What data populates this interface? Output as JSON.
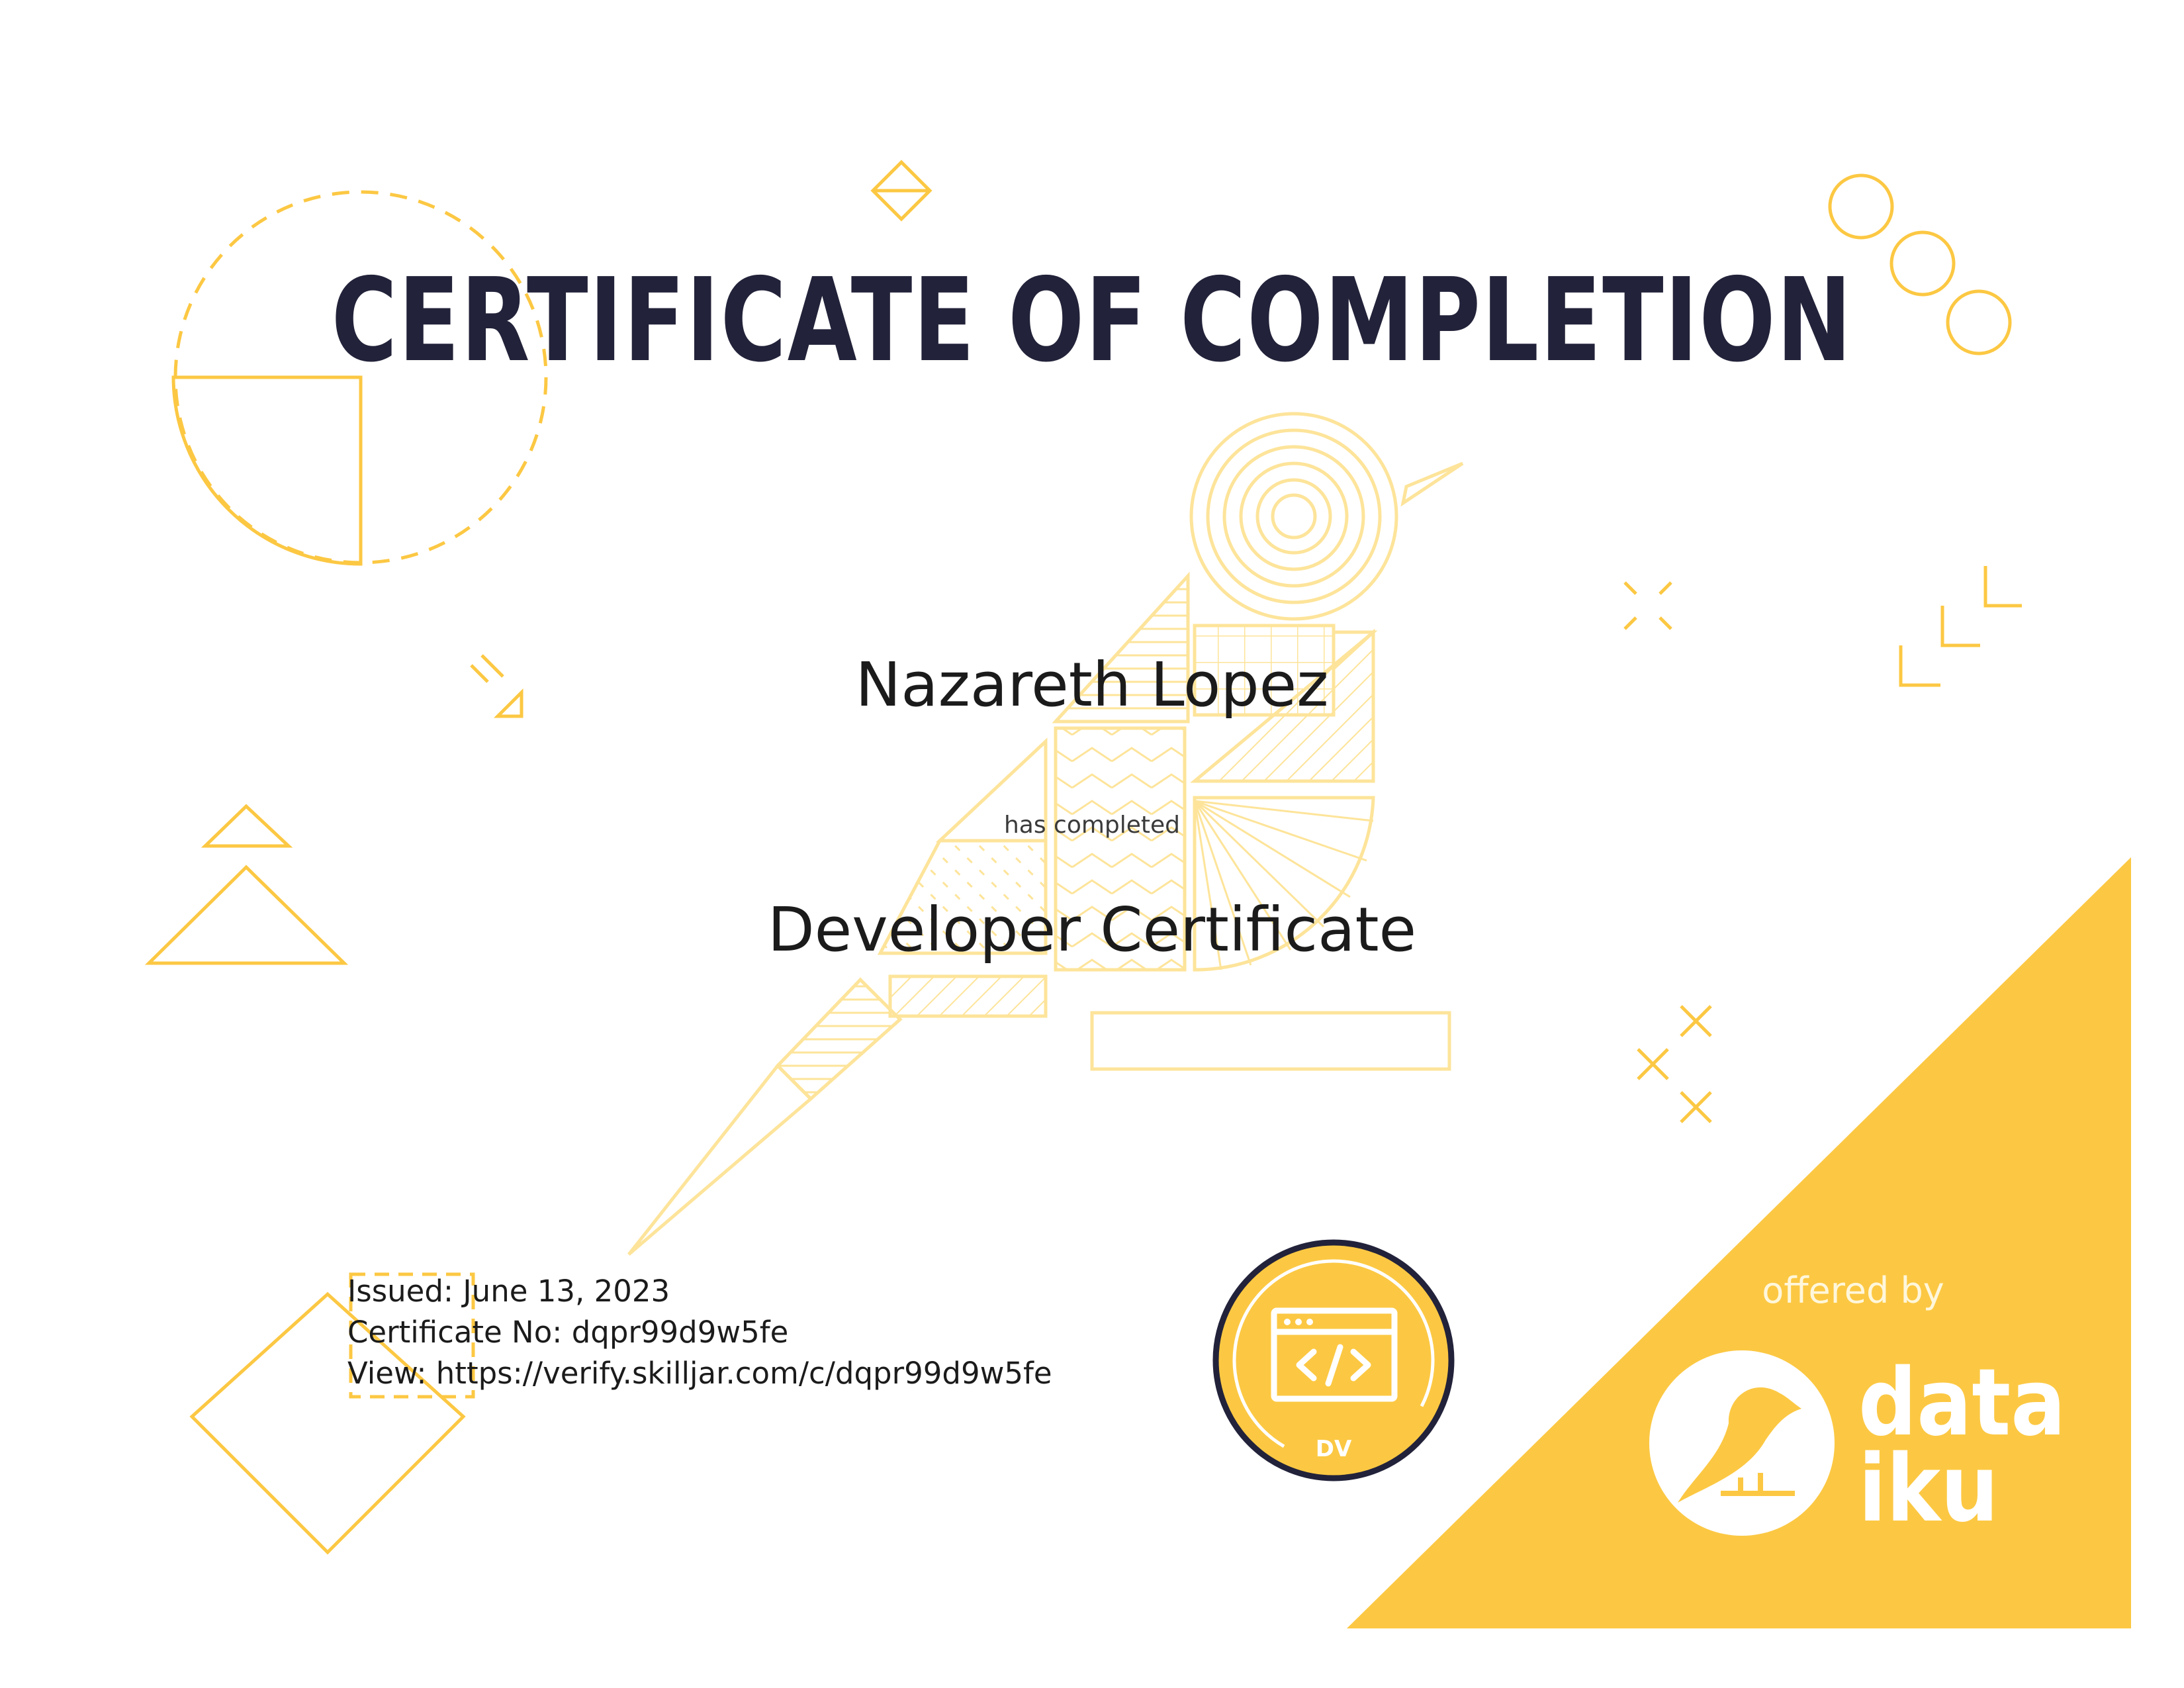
{
  "certificate": {
    "title": "CERTIFICATE OF COMPLETION",
    "recipient": "Nazareth Lopez",
    "completed_text": "has completed",
    "course": "Developer Certificate",
    "issued": "Issued: June 13, 2023",
    "certificate_no": "Certificate No: dqpr99d9w5fe",
    "view_url": "View: https://verify.skilljar.com/c/dqpr99d9w5fe"
  },
  "badge": {
    "label": "DV",
    "icon": "code-window-icon"
  },
  "sponsor": {
    "offered_by": "offered by",
    "brand_line1": "data",
    "brand_line2": "iku",
    "logo_icon": "bird-logo-icon"
  },
  "colors": {
    "accent": "#fcc843",
    "accent_light": "#fde49a",
    "title": "#22223a",
    "badge_ring": "#22223a"
  }
}
